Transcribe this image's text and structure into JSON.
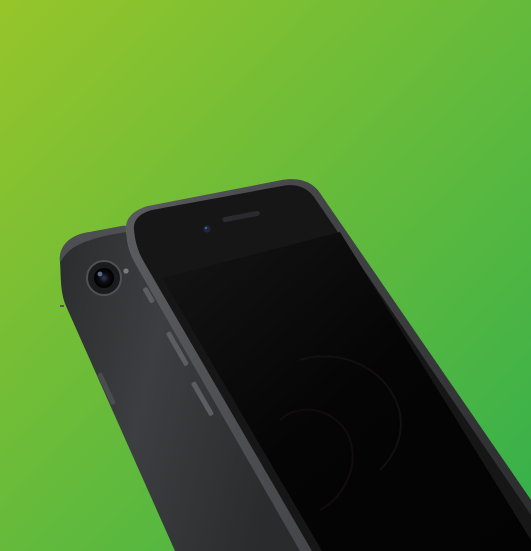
{
  "scene": {
    "subject": "phones",
    "background": {
      "gradient_start": "#97c52a",
      "gradient_end": "#33b04c"
    },
    "back_phone": {
      "finish": "space-gray",
      "body_color": "#3a3b3d",
      "edge_color": "#55565a"
    },
    "front_phone": {
      "bezel_color": "#161617",
      "frame_color": "#47484c",
      "screen_color": "#050505",
      "earpiece": true,
      "front_camera": true
    }
  }
}
